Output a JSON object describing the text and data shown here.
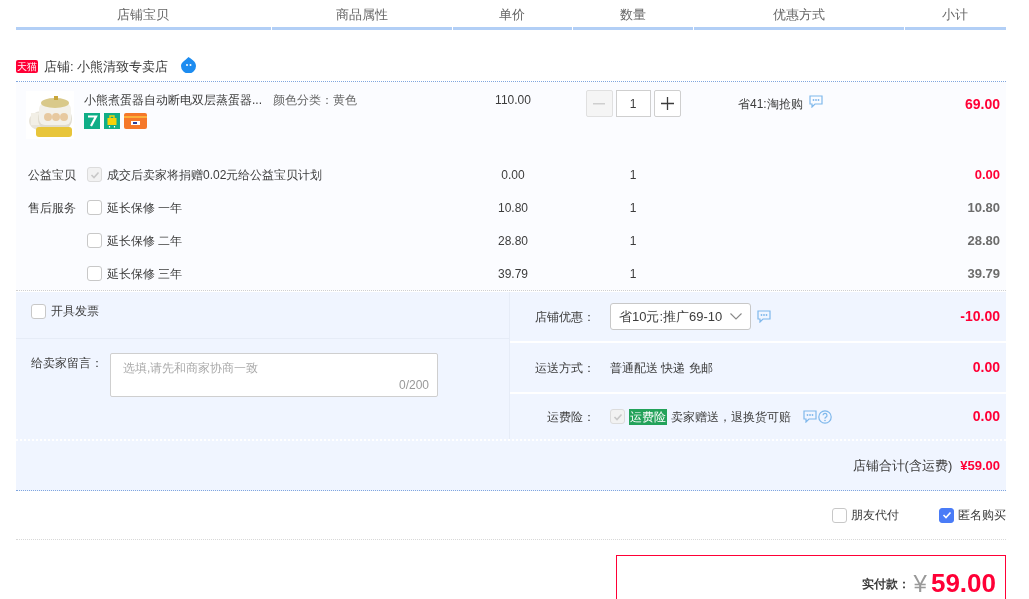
{
  "header": {
    "columns": [
      "店铺宝贝",
      "商品属性",
      "单价",
      "数量",
      "优惠方式",
      "小计"
    ]
  },
  "shop": {
    "badge": "天猫",
    "name": "店铺: 小熊清致专卖店"
  },
  "item": {
    "title": "小熊煮蛋器自动断电双层蒸蛋器...",
    "attribute": "颜色分类：黄色",
    "price": "110.00",
    "quantity": "1",
    "promo": "省41:淘抢购",
    "subtotal": "69.00"
  },
  "services": [
    {
      "kind": "charity",
      "label": "公益宝贝",
      "checked": true,
      "disabled": true,
      "text": "成交后卖家将捐赠0.02元给公益宝贝计划",
      "price": "0.00",
      "quantity": "1",
      "subtotal": "0.00"
    },
    {
      "kind": "warranty",
      "label": "售后服务",
      "checked": false,
      "disabled": false,
      "text": "延长保修 一年",
      "price": "10.80",
      "quantity": "1",
      "subtotal": "10.80"
    },
    {
      "kind": "warranty",
      "checked": false,
      "disabled": false,
      "text": "延长保修 二年",
      "price": "28.80",
      "quantity": "1",
      "subtotal": "28.80"
    },
    {
      "kind": "warranty",
      "checked": false,
      "disabled": false,
      "text": "延长保修 三年",
      "price": "39.79",
      "quantity": "1",
      "subtotal": "39.79"
    }
  ],
  "invoice": {
    "label": "开具发票",
    "checked": false
  },
  "message": {
    "label": "给卖家留言：",
    "placeholder": "选填,请先和商家协商一致",
    "counter": "0/200"
  },
  "discount": {
    "label": "店铺优惠：",
    "value": "省10元:推广69-10",
    "amount": "-10.00"
  },
  "shipping": {
    "label": "运送方式：",
    "value": "普通配送 快递 免邮",
    "amount": "0.00"
  },
  "insurance": {
    "label": "运费险：",
    "checked": true,
    "disabled": true,
    "tag": "运费险",
    "text": "卖家赠送，退换货可赔",
    "amount": "0.00"
  },
  "total": {
    "label": "店铺合计(含运费)",
    "amount": "¥59.00"
  },
  "options": [
    {
      "label": "朋友代付",
      "checked": false
    },
    {
      "label": "匿名购买",
      "checked": true
    }
  ],
  "payment": {
    "label": "实付款：",
    "currency": "¥",
    "amount": "59.00"
  }
}
